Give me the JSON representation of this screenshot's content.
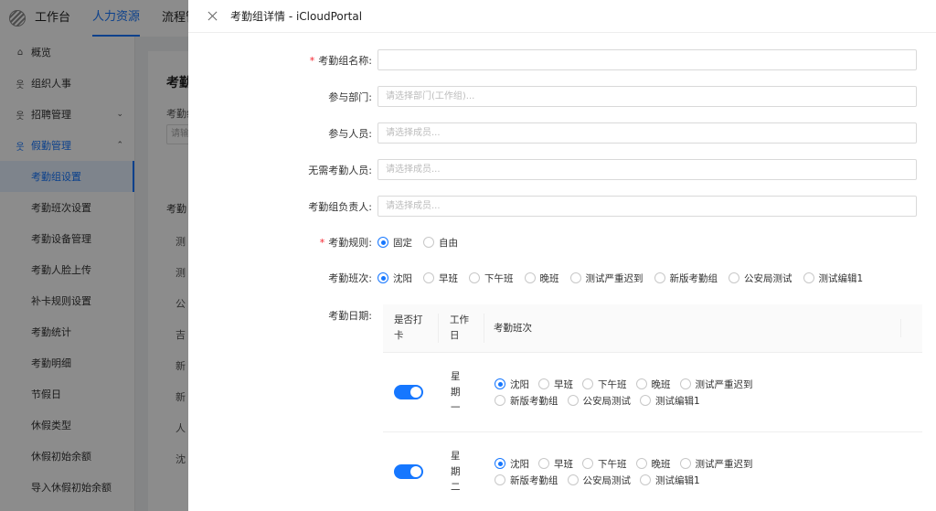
{
  "topnav": [
    "工作台",
    "人力资源",
    "流程管"
  ],
  "sidebar": {
    "items": [
      {
        "label": "概览",
        "icon": "home-icon",
        "type": "top"
      },
      {
        "label": "组织人事",
        "icon": "people-icon",
        "type": "top"
      },
      {
        "label": "招聘管理",
        "icon": "people-icon",
        "type": "top",
        "arrow": "⌄"
      },
      {
        "label": "假勤管理",
        "icon": "people-icon",
        "type": "group",
        "arrow": "⌃"
      },
      {
        "label": "考勤组设置",
        "type": "sub",
        "selected": true
      },
      {
        "label": "考勤班次设置",
        "type": "sub"
      },
      {
        "label": "考勤设备管理",
        "type": "sub"
      },
      {
        "label": "考勤人脸上传",
        "type": "sub"
      },
      {
        "label": "补卡规则设置",
        "type": "sub"
      },
      {
        "label": "考勤统计",
        "type": "sub"
      },
      {
        "label": "考勤明细",
        "type": "sub"
      },
      {
        "label": "节假日",
        "type": "sub"
      },
      {
        "label": "休假类型",
        "type": "sub"
      },
      {
        "label": "休假初始余额",
        "type": "sub"
      },
      {
        "label": "导入休假初始余额",
        "type": "sub"
      }
    ]
  },
  "main": {
    "title": "考勤",
    "filter_label": "考勤组",
    "filter_placeholder": "请输",
    "table_header": "考勤",
    "rows": [
      "测",
      "测",
      "公",
      "吉",
      "新",
      "新",
      "人",
      "沈"
    ]
  },
  "drawer": {
    "title": "考勤组详情 - iCloudPortal",
    "fields": {
      "name": {
        "label": "考勤组名称",
        "required": true,
        "value": ""
      },
      "dept": {
        "label": "参与部门",
        "placeholder": "请选择部门(工作组)..."
      },
      "members": {
        "label": "参与人员",
        "placeholder": "请选择成员..."
      },
      "exempt": {
        "label": "无需考勤人员",
        "placeholder": "请选择成员..."
      },
      "owner": {
        "label": "考勤组负责人",
        "placeholder": "请选择成员..."
      }
    },
    "rule": {
      "label": "考勤规则",
      "required": true,
      "options": [
        "固定",
        "自由"
      ],
      "selected": 0
    },
    "shift": {
      "label": "考勤班次",
      "options": [
        "沈阳",
        "早班",
        "下午班",
        "晚班",
        "测试严重迟到",
        "新版考勤组",
        "公安局测试",
        "测试编辑1"
      ],
      "selected": 0
    },
    "date": {
      "label": "考勤日期",
      "headers": {
        "punch": [
          "是否打",
          "卡"
        ],
        "day": [
          "工作",
          "日"
        ],
        "shift": "考勤班次"
      },
      "rows": [
        {
          "day": [
            "星",
            "期",
            "一"
          ],
          "on": true,
          "shifts": [
            "沈阳",
            "早班",
            "下午班",
            "晚班",
            "测试严重迟到",
            "新版考勤组",
            "公安局测试",
            "测试编辑1"
          ],
          "selected": 0
        },
        {
          "day": [
            "星",
            "期",
            "二"
          ],
          "on": true,
          "shifts": [
            "沈阳",
            "早班",
            "下午班",
            "晚班",
            "测试严重迟到",
            "新版考勤组",
            "公安局测试",
            "测试编辑1"
          ],
          "selected": 0
        }
      ]
    }
  },
  "colors": {
    "accent": "#1677ff",
    "required": "#f5222d"
  }
}
